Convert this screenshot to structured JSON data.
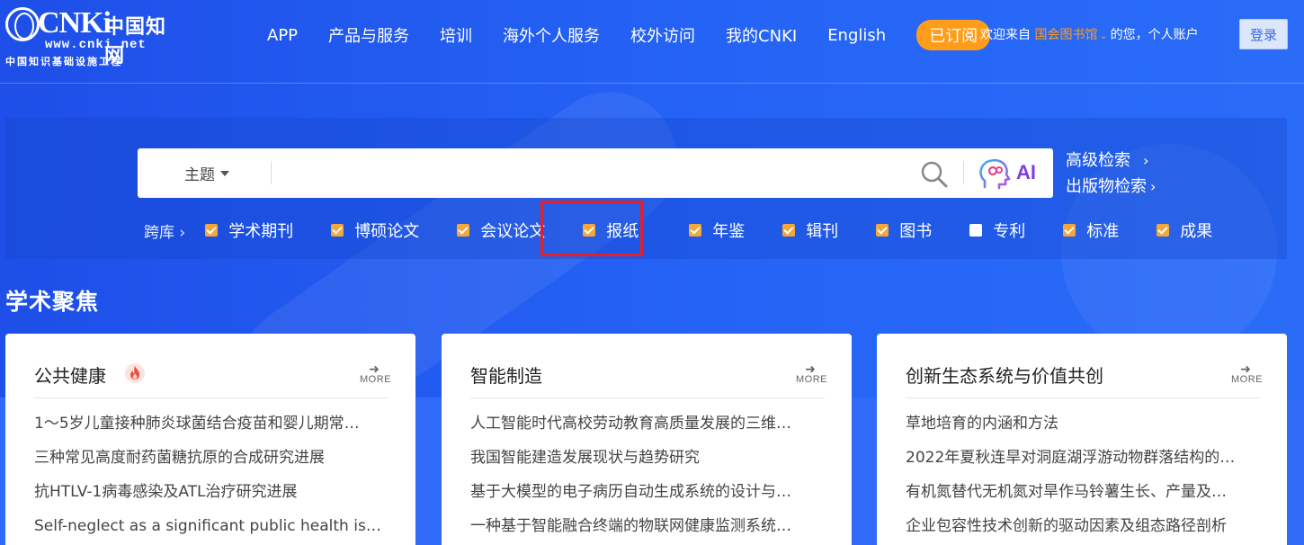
{
  "logo": {
    "brand": "CNKi",
    "brand_cn": "中国知网",
    "url": "www.cnki.net",
    "tagline": "中国知识基础设施工程"
  },
  "nav": {
    "items": [
      "APP",
      "产品与服务",
      "培训",
      "海外个人服务",
      "校外访问",
      "我的CNKI",
      "English"
    ],
    "subscribed_label": "已订阅"
  },
  "user": {
    "welcome_prefix": "欢迎来自",
    "library": "国会图书馆",
    "welcome_suffix": "的您，个人账户",
    "login_label": "登录"
  },
  "search": {
    "field": "主题",
    "query": "",
    "ai_label": "AI",
    "advanced_label": "高级检索",
    "publication_label": "出版物检索"
  },
  "scope": {
    "label": "跨库",
    "items": [
      {
        "label": "学术期刊",
        "checked": true
      },
      {
        "label": "博硕论文",
        "checked": true
      },
      {
        "label": "会议论文",
        "checked": true
      },
      {
        "label": "报纸",
        "checked": true
      },
      {
        "label": "年鉴",
        "checked": true
      },
      {
        "label": "辑刊",
        "checked": true
      },
      {
        "label": "图书",
        "checked": true
      },
      {
        "label": "专利",
        "checked": false
      },
      {
        "label": "标准",
        "checked": true
      },
      {
        "label": "成果",
        "checked": true
      }
    ],
    "highlighted": "报纸"
  },
  "section": {
    "title": "学术聚焦"
  },
  "cards": [
    {
      "title": "公共健康",
      "hot": true,
      "more": "MORE",
      "items": [
        "1～5岁儿童接种肺炎球菌结合疫苗和婴儿期常…",
        "三种常见高度耐药菌糖抗原的合成研究进展",
        "抗HTLV-1病毒感染及ATL治疗研究进展",
        "Self-neglect as a significant public health issu…"
      ]
    },
    {
      "title": "智能制造",
      "hot": false,
      "more": "MORE",
      "items": [
        "人工智能时代高校劳动教育高质量发展的三维…",
        "我国智能建造发展现状与趋势研究",
        "基于大模型的电子病历自动生成系统的设计与…",
        "一种基于智能融合终端的物联网健康监测系统…"
      ]
    },
    {
      "title": "创新生态系统与价值共创",
      "hot": false,
      "more": "MORE",
      "items": [
        "草地培育的内涵和方法",
        "2022年夏秋连旱对洞庭湖浮游动物群落结构的…",
        "有机氮替代无机氮对旱作马铃薯生长、产量及…",
        "企业包容性技术创新的驱动因素及组态路径剖析"
      ]
    }
  ],
  "colors": {
    "background": "#1f55f0",
    "accent_orange": "#ff9c1a",
    "checkbox": "#f2a83a",
    "highlight": "#e0202a",
    "ai_purple": "#7b3fe4"
  }
}
